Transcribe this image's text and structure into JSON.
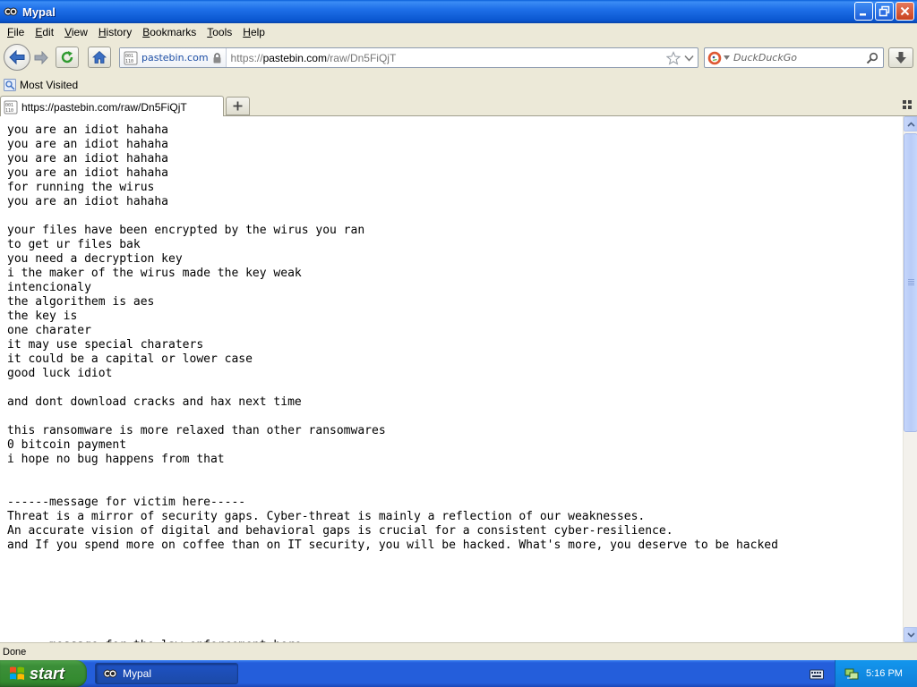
{
  "window": {
    "title": "Mypal"
  },
  "menu": [
    {
      "label": "File",
      "accel": "F",
      "rest": "ile"
    },
    {
      "label": "Edit",
      "accel": "E",
      "rest": "dit"
    },
    {
      "label": "View",
      "accel": "V",
      "rest": "iew"
    },
    {
      "label": "History",
      "accel": "H",
      "rest": "istory"
    },
    {
      "label": "Bookmarks",
      "accel": "B",
      "rest": "ookmarks"
    },
    {
      "label": "Tools",
      "accel": "T",
      "rest": "ools"
    },
    {
      "label": "Help",
      "accel": "H",
      "rest": "elp"
    }
  ],
  "urlbar": {
    "site": "pastebin.com",
    "url_prefix": "https://",
    "url_host": "pastebin.com",
    "url_path": "/raw/Dn5FiQjT"
  },
  "search": {
    "placeholder": "DuckDuckGo"
  },
  "bookmarks": {
    "most_visited": "Most Visited"
  },
  "tab": {
    "title": "https://pastebin.com/raw/Dn5FiQjT"
  },
  "content": {
    "text": "you are an idiot hahaha\nyou are an idiot hahaha\nyou are an idiot hahaha\nyou are an idiot hahaha\nfor running the wirus\nyou are an idiot hahaha\n\nyour files have been encrypted by the wirus you ran\nto get ur files bak\nyou need a decryption key\ni the maker of the wirus made the key weak\nintencionaly\nthe algorithem is aes\nthe key is\none charater\nit may use special charaters\nit could be a capital or lower case\ngood luck idiot\n\nand dont download cracks and hax next time\n\nthis ransomware is more relaxed than other ransomwares\n0 bitcoin payment\ni hope no bug happens from that\n\n\n------message for victim here-----\nThreat is a mirror of security gaps. Cyber-threat is mainly a reflection of our weaknesses.\nAn accurate vision of digital and behavioral gaps is crucial for a consistent cyber-resilience.\nand If you spend more on coffee than on IT security, you will be hacked. What's more, you deserve to be hacked\n\n\n\n\n\n\n------message for the law enforcement here-----"
  },
  "status": {
    "text": "Done"
  },
  "taskbar": {
    "start_label": "start",
    "task_label": "Mypal",
    "clock": "5:16 PM"
  },
  "colors": {
    "titlebar": "#0a56d0",
    "taskbar": "#245edb",
    "start": "#338a2f",
    "tray": "#1396ed"
  }
}
